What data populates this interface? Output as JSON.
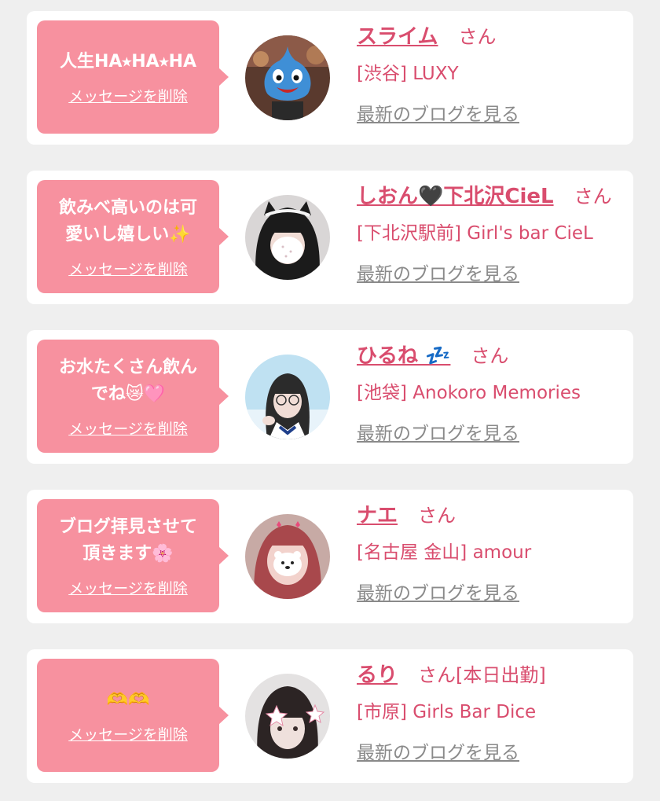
{
  "messages": [
    {
      "bubble_text": "人生HA⭑HA⭑HA",
      "delete_label": "メッセージを削除",
      "name": "スライム",
      "san": "さん",
      "shop": "[渋谷] LUXY",
      "blog_link": "最新のブログを見る",
      "avatar_desc": "slime-avatar"
    },
    {
      "bubble_text": "飲みべ高いのは可\n愛いし嬉しい✨",
      "delete_label": "メッセージを削除",
      "name": "しおん🖤下北沢CieL",
      "san": "さん",
      "shop": "[下北沢駅前] Girl's bar CieL",
      "blog_link": "最新のブログを見る",
      "avatar_desc": "masked-girl-avatar"
    },
    {
      "bubble_text": "お水たくさん飲ん\nでね😿🩷",
      "delete_label": "メッセージを削除",
      "name": "ひるね 💤",
      "san": "さん",
      "shop": "[池袋] Anokoro Memories",
      "blog_link": "最新のブログを見る",
      "avatar_desc": "glasses-girl-avatar"
    },
    {
      "bubble_text": "ブログ拝見させて\n頂きます🌸",
      "delete_label": "メッセージを削除",
      "name": "ナエ",
      "san": "さん",
      "shop": "[名古屋 金山] amour",
      "blog_link": "最新のブログを見る",
      "avatar_desc": "redhair-girl-avatar"
    },
    {
      "bubble_text": "🫶🫶",
      "delete_label": "メッセージを削除",
      "name": "るり",
      "san": "さん[本日出勤]",
      "shop": "[市原] Girls Bar Dice",
      "blog_link": "最新のブログを見る",
      "avatar_desc": "bangs-girl-avatar"
    }
  ],
  "colors": {
    "page_bg": "#efefef",
    "bubble": "#f7919f",
    "accent": "#d94d6e",
    "link_gray": "#8a8a8a"
  }
}
